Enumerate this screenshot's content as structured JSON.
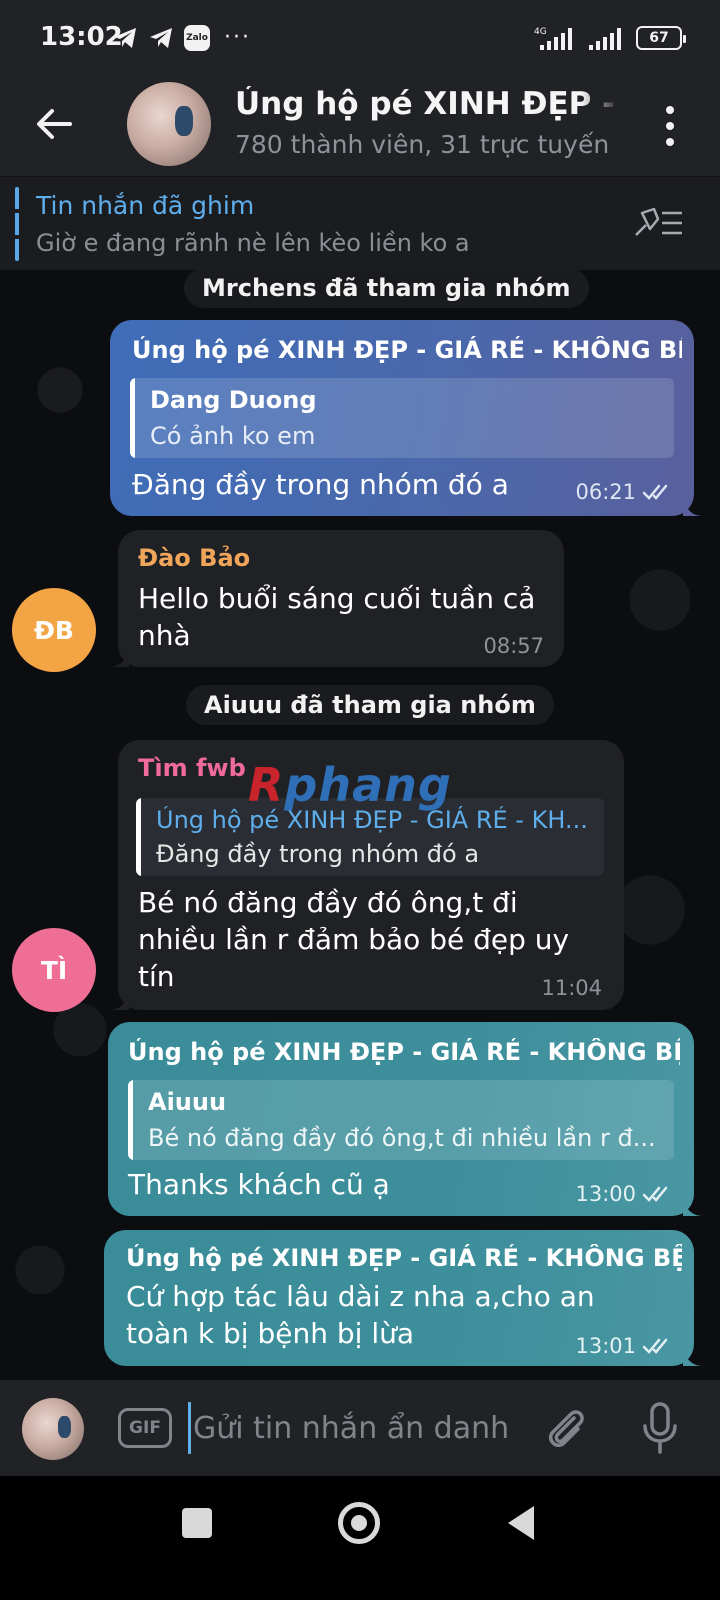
{
  "status_bar": {
    "time": "13:02",
    "zalo_label": "Zalo",
    "more_dots": "···",
    "battery": "67",
    "network_label": "4G"
  },
  "header": {
    "title": "Ủng hộ pé XINH ĐẸP - G",
    "subtitle": "780 thành viên, 31 trực tuyến"
  },
  "pinned": {
    "title": "Tin nhắn đã ghim",
    "text": "Giờ e đang rãnh nè lên kèo liền ko a"
  },
  "messages": [
    {
      "kind": "service",
      "text": "Mrchens đã tham gia nhóm"
    },
    {
      "kind": "outgoing",
      "sender": "Ủng hộ pé XINH ĐẸP - GIÁ RẺ - KHÔNG BỆ...",
      "reply_name": "Dang Duong",
      "reply_text": "Có ảnh ko em",
      "text": "Đăng đầy trong nhóm đó a",
      "time": "06:21"
    },
    {
      "kind": "incoming",
      "sender": "Đào Bảo",
      "avatar_initials": "ĐB",
      "text": "Hello buổi sáng cuối tuần cả nhà",
      "time": "08:57"
    },
    {
      "kind": "service",
      "text": "Aiuuu đã tham gia nhóm"
    },
    {
      "kind": "incoming",
      "sender": "Tìm fwb",
      "avatar_initials": "TÌ",
      "reply_name": "Ủng hộ pé XINH ĐẸP - GIÁ RẺ - KH...",
      "reply_text": "Đăng đầy trong nhóm đó a",
      "text": "Bé nó đăng đầy đó ông,t đi nhiều lần r đảm bảo bé đẹp uy tín",
      "time": "11:04"
    },
    {
      "kind": "outgoing",
      "sender": "Ủng hộ pé XINH ĐẸP - GIÁ RẺ - KHÔNG BỆ...",
      "reply_name": "Aiuuu",
      "reply_text": "Bé nó đăng đầy đó ông,t đi nhiều lần r đ...",
      "text": "Thanks khách cũ ạ",
      "time": "13:00"
    },
    {
      "kind": "outgoing",
      "sender": "Ủng hộ pé XINH ĐẸP - GIÁ RẺ - KHÔNG BỆ...",
      "text": "Cứ hợp tác lâu dài z nha a,cho an toàn k bị bệnh bị lừa",
      "time": "13:01"
    }
  ],
  "watermark": {
    "first": "R",
    "rest": "phang"
  },
  "input": {
    "gif_label": "GIF",
    "placeholder": "Gửi tin nhắn ẩn danh"
  },
  "colors": {
    "link_blue": "#5eaeec",
    "name_orange": "#f0a65a",
    "name_pink": "#f06b99",
    "avatar_orange": "#f3a545",
    "avatar_pink": "#ee6e96",
    "bubble_blue": "#4a68ab",
    "bubble_teal": "#3d8f9b",
    "bubble_dark": "#202125"
  },
  "icons": [
    "telegram-icon",
    "zalo-icon",
    "signal-icon",
    "battery-icon",
    "back-arrow-icon",
    "kebab-menu-icon",
    "unpin-icon",
    "double-check-icon",
    "gif-icon",
    "paperclip-icon",
    "microphone-icon",
    "nav-recents-icon",
    "nav-home-icon",
    "nav-back-icon"
  ]
}
